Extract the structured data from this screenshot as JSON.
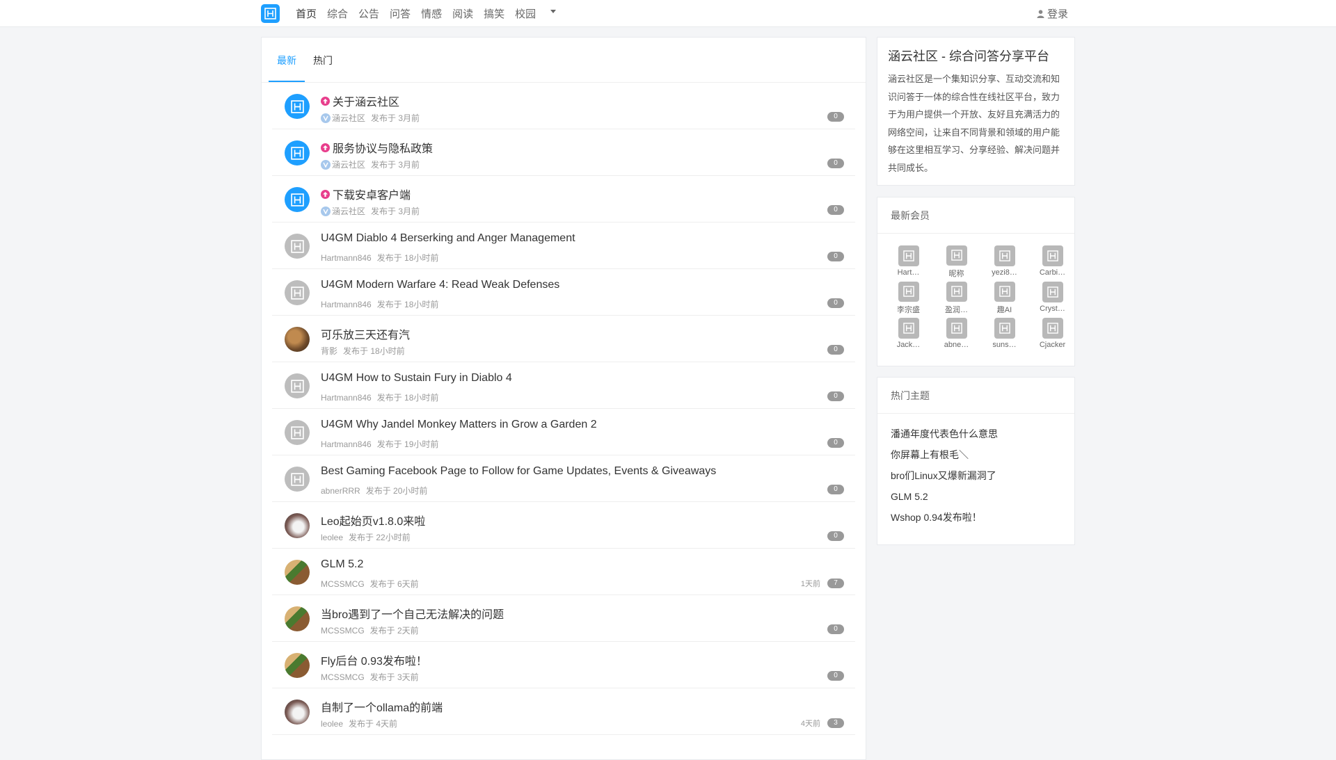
{
  "nav": {
    "items": [
      "首页",
      "综合",
      "公告",
      "问答",
      "情感",
      "阅读",
      "搞笑",
      "校园"
    ],
    "login_label": "登录",
    "logo_icon": "h-logo-icon",
    "accent_color": "#1e9fff"
  },
  "tabs": [
    "最新",
    "热门"
  ],
  "topics": [
    {
      "title": "关于涵云社区",
      "author": "涵云社区",
      "posted": "发布于 3月前",
      "count": "0",
      "pinned": true,
      "verified": true,
      "avatar": "blue"
    },
    {
      "title": "服务协议与隐私政策",
      "author": "涵云社区",
      "posted": "发布于 3月前",
      "count": "0",
      "pinned": true,
      "verified": true,
      "avatar": "blue"
    },
    {
      "title": "下载安卓客户端",
      "author": "涵云社区",
      "posted": "发布于 3月前",
      "count": "0",
      "pinned": true,
      "verified": true,
      "avatar": "blue"
    },
    {
      "title": "U4GM Diablo 4 Berserking and Anger Management",
      "author": "Hartmann846",
      "posted": "发布于 18小时前",
      "count": "0",
      "avatar": "gray"
    },
    {
      "title": "U4GM Modern Warfare 4: Read Weak Defenses",
      "author": "Hartmann846",
      "posted": "发布于 18小时前",
      "count": "0",
      "avatar": "gray"
    },
    {
      "title": "可乐放三天还有汽",
      "author": "背影",
      "posted": "发布于 18小时前",
      "count": "0",
      "avatar": "photo-cap"
    },
    {
      "title": "U4GM How to Sustain Fury in Diablo 4",
      "author": "Hartmann846",
      "posted": "发布于 18小时前",
      "count": "0",
      "avatar": "gray"
    },
    {
      "title": "U4GM Why Jandel Monkey Matters in Grow a Garden 2",
      "author": "Hartmann846",
      "posted": "发布于 19小时前",
      "count": "0",
      "avatar": "gray"
    },
    {
      "title": "Best Gaming Facebook Page to Follow for Game Updates, Events & Giveaways",
      "author": "abnerRRR",
      "posted": "发布于 20小时前",
      "count": "0",
      "avatar": "gray"
    },
    {
      "title": "Leo起始页v1.8.0来啦",
      "author": "leolee",
      "posted": "发布于 22小时前",
      "count": "0",
      "avatar": "photo-lee"
    },
    {
      "title": "GLM 5.2",
      "author": "MCSSMCG",
      "posted": "发布于 6天前",
      "count": "7",
      "last_reply": "1天前",
      "avatar": "photo-mc"
    },
    {
      "title": "当bro遇到了一个自己无法解决的问题",
      "author": "MCSSMCG",
      "posted": "发布于 2天前",
      "count": "0",
      "avatar": "photo-mc"
    },
    {
      "title": "Fly后台 0.93发布啦！",
      "author": "MCSSMCG",
      "posted": "发布于 3天前",
      "count": "0",
      "avatar": "photo-mc"
    },
    {
      "title": "自制了一个ollama的前端",
      "author": "leolee",
      "posted": "发布于 4天前",
      "count": "3",
      "last_reply": "4天前",
      "avatar": "photo-lee"
    }
  ],
  "about": {
    "title": "涵云社区 - 综合问答分享平台",
    "text": "涵云社区是一个集知识分享、互动交流和知识问答于一体的综合性在线社区平台，致力于为用户提供一个开放、友好且充满活力的网络空间，让来自不同背景和领域的用户能够在这里相互学习、分享经验、解决问题并共同成长。"
  },
  "members": {
    "title": "最新会员",
    "list": [
      "Hart…",
      "昵称",
      "yezi8…",
      "Carbi…",
      "李宗盛",
      "盈润…",
      "趣AI",
      "Cryst…",
      "Jack…",
      "abne…",
      "suns…",
      "Cjacker"
    ]
  },
  "hot": {
    "title": "热门主题",
    "list": [
      "潘通年度代表色什么意思",
      "你屏幕上有根毛＼",
      "bro们Linux又爆新漏洞了",
      "GLM 5.2",
      "Wshop 0.94发布啦！"
    ]
  }
}
